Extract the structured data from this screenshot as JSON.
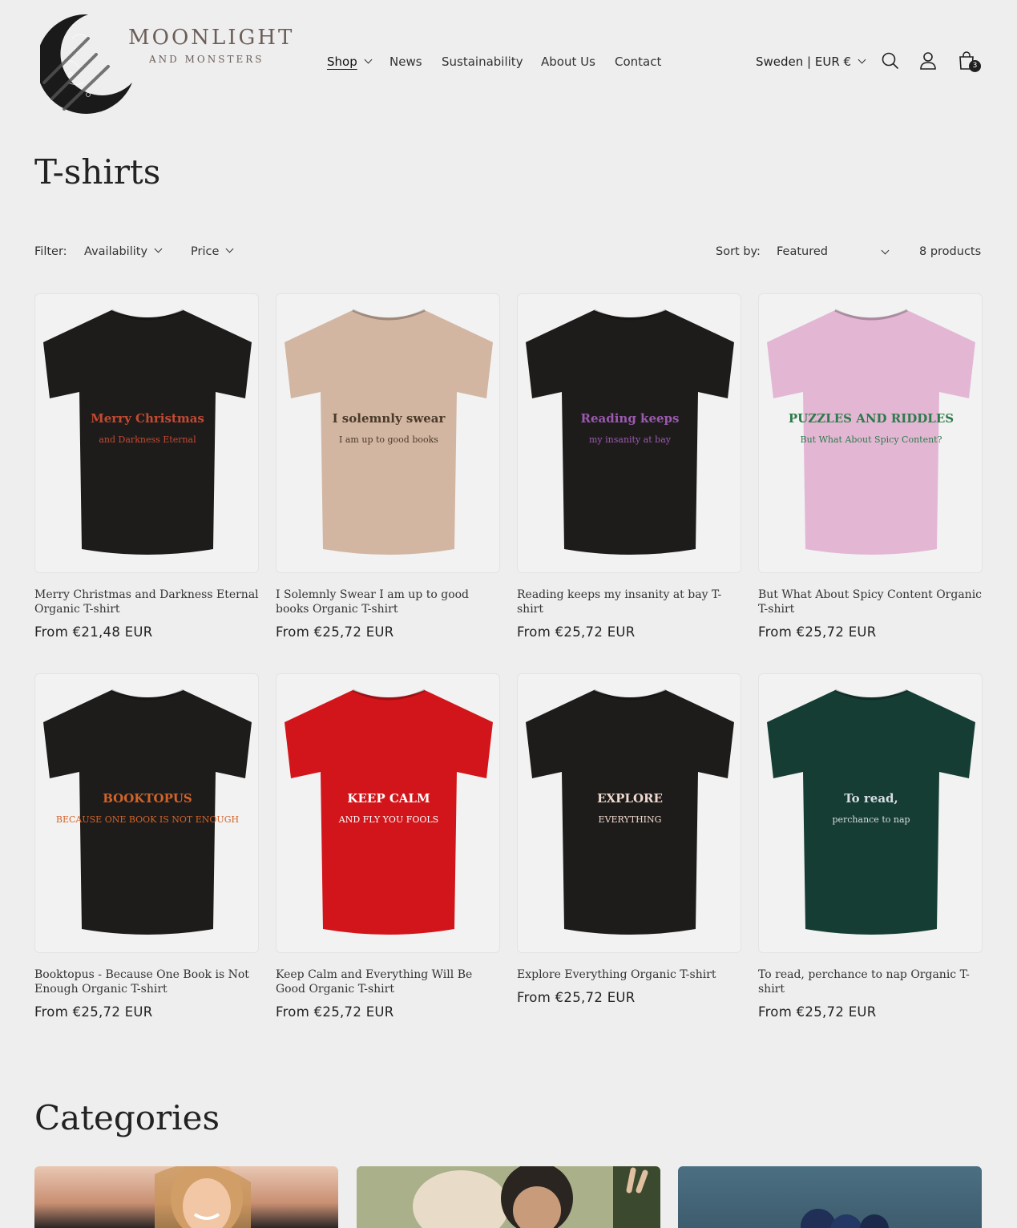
{
  "brand": {
    "name": "MOONLIGHT",
    "sub": "AND MONSTERS"
  },
  "nav": {
    "items": [
      {
        "label": "Shop"
      },
      {
        "label": "News"
      },
      {
        "label": "Sustainability"
      },
      {
        "label": "About Us"
      },
      {
        "label": "Contact"
      }
    ]
  },
  "header": {
    "locale": "Sweden | EUR €",
    "cart_count": "3",
    "icons": [
      "search-icon",
      "account-icon",
      "cart-icon"
    ]
  },
  "page": {
    "title": "T-shirts"
  },
  "filters": {
    "label": "Filter:",
    "availability": "Availability",
    "price": "Price",
    "sort_label": "Sort by:",
    "sort_value": "Featured",
    "count": "8 products"
  },
  "products": [
    {
      "title": "Merry Christmas and Darkness Eternal Organic T-shirt",
      "price": "From €21,48 EUR",
      "shirt_color": "#1e1c1b",
      "print_text": "Merry Christmas",
      "print_text2": "and Darkness Eternal",
      "print_color": "#c24a33"
    },
    {
      "title": "I Solemnly Swear I am up to good books Organic T-shirt",
      "price": "From €25,72 EUR",
      "shirt_color": "#d2b6a2",
      "print_text": "I solemnly swear",
      "print_text2": "I am up to good books",
      "print_color": "#4a3a2a"
    },
    {
      "title": "Reading keeps my insanity at bay T-shirt",
      "price": "From €25,72 EUR",
      "shirt_color": "#1e1c1b",
      "print_text": "Reading keeps",
      "print_text2": "my insanity at bay",
      "print_color": "#9b59b0"
    },
    {
      "title": "But What About Spicy Content Organic T-shirt",
      "price": "From €25,72 EUR",
      "shirt_color": "#e3b7d4",
      "print_text": "PUZZLES AND RIDDLES",
      "print_text2": "But What About Spicy Content?",
      "print_color": "#2d7a4a"
    },
    {
      "title": "Booktopus - Because One Book is Not Enough Organic T-shirt",
      "price": "From €25,72 EUR",
      "shirt_color": "#1e1c1b",
      "print_text": "BOOKTOPUS",
      "print_text2": "BECAUSE ONE BOOK IS NOT ENOUGH",
      "print_color": "#d2642a"
    },
    {
      "title": "Keep Calm and Everything Will Be Good Organic T-shirt",
      "price": "From €25,72 EUR",
      "shirt_color": "#d2151a",
      "print_text": "KEEP CALM",
      "print_text2": "AND FLY YOU FOOLS",
      "print_color": "#ffffff"
    },
    {
      "title": "Explore Everything Organic T-shirt",
      "price": "From €25,72 EUR",
      "shirt_color": "#1e1c1b",
      "print_text": "EXPLORE",
      "print_text2": "EVERYTHING",
      "print_color": "#f0d9cf"
    },
    {
      "title": "To read, perchance to nap Organic T-shirt",
      "price": "From €25,72 EUR",
      "shirt_color": "#153d33",
      "print_text": "To read,",
      "print_text2": "perchance to nap",
      "print_color": "#d9dee6"
    }
  ],
  "categories": {
    "title": "Categories",
    "cards": [
      {
        "name": "category-women"
      },
      {
        "name": "category-people"
      },
      {
        "name": "category-blueberries"
      }
    ]
  }
}
